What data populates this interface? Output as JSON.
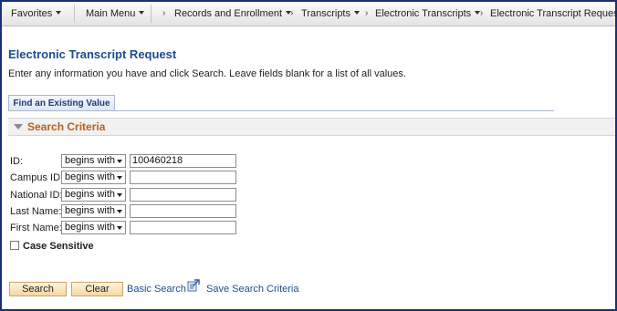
{
  "nav": {
    "favorites": "Favorites",
    "main_menu": "Main Menu",
    "breadcrumbs": [
      "Records and Enrollment",
      "Transcripts",
      "Electronic Transcripts",
      "Electronic Transcript Request"
    ]
  },
  "page": {
    "title": "Electronic Transcript Request",
    "instructions": "Enter any information you have and click Search. Leave fields blank for a list of all values."
  },
  "tab": {
    "label": "Find an Existing Value"
  },
  "criteria": {
    "title": "Search Criteria",
    "fields": [
      {
        "label": "ID:",
        "operator": "begins with",
        "value": "100460218"
      },
      {
        "label": "Campus ID:",
        "operator": "begins with",
        "value": ""
      },
      {
        "label": "National ID:",
        "operator": "begins with",
        "value": ""
      },
      {
        "label": "Last Name:",
        "operator": "begins with",
        "value": ""
      },
      {
        "label": "First Name:",
        "operator": "begins with",
        "value": ""
      }
    ],
    "case_sensitive_label": "Case Sensitive",
    "case_sensitive_checked": false
  },
  "actions": {
    "search": "Search",
    "clear": "Clear",
    "basic_search": "Basic Search",
    "save_search_criteria": "Save Search Criteria"
  },
  "icons": {
    "save": "save-search-icon"
  },
  "colors": {
    "frame": "#1a2f7a",
    "title": "#1d4c8a",
    "section": "#b8601a",
    "link": "#1b4f8f"
  }
}
